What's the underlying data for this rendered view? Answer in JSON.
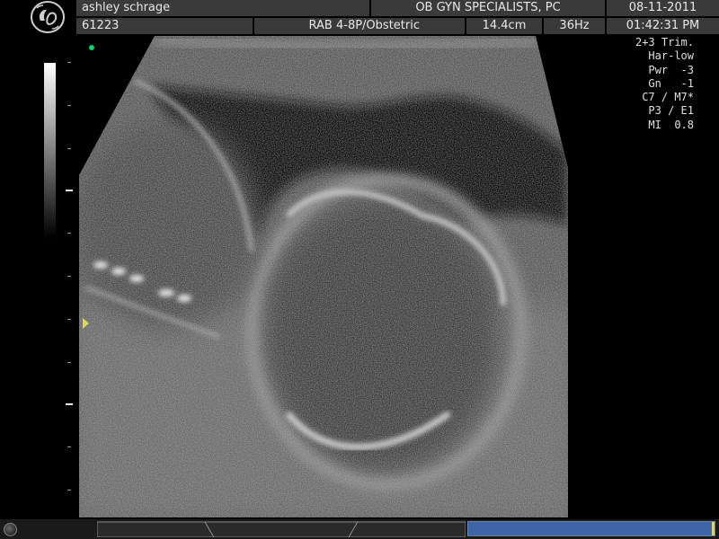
{
  "header": {
    "patient_name": "ashley schrage",
    "institution": "OB GYN SPECIALISTS, PC",
    "date": "08-11-2011",
    "patient_id": "61223",
    "probe_app": "RAB 4-8P/Obstetric",
    "depth": "14.4cm",
    "frame_rate": "36Hz",
    "time": "01:42:31 PM"
  },
  "params": [
    "2+3 Trim.",
    "Har-low",
    "Pwr  -3",
    "Gn   -1",
    "C7 / M7*",
    "P3 / E1",
    "MI  0.8"
  ],
  "icons": {
    "logo": "ge-logo",
    "focus": "focus-marker-icon",
    "status": "green-status-dot-icon",
    "knob": "trackball-icon"
  },
  "colors": {
    "header_cell": "#3a3a3a",
    "status_dot": "#00d46a",
    "focus_marker": "#d8d860",
    "progress": "#3e65a8"
  },
  "progress": {
    "fraction": 1.0
  }
}
